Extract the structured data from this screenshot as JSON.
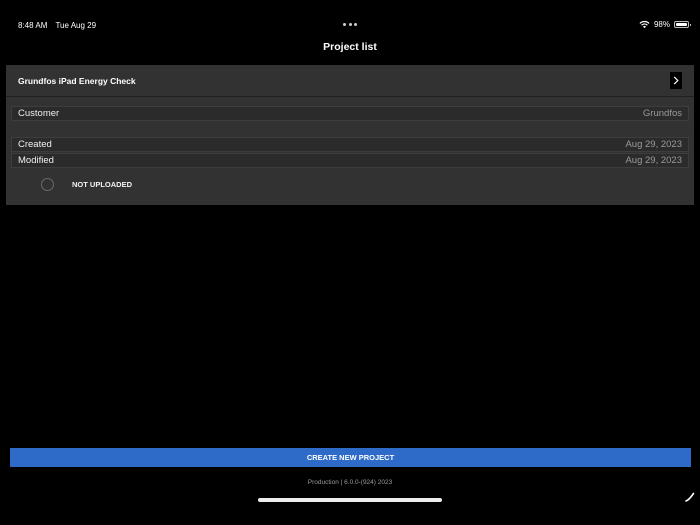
{
  "status_bar": {
    "time": "8:48 AM",
    "date": "Tue Aug 29",
    "battery": "98%",
    "icons": [
      "multitasking-dots-icon",
      "wifi-icon",
      "battery-icon"
    ]
  },
  "nav": {
    "title": "Project list"
  },
  "project": {
    "name": "Grundfos iPad Energy Check",
    "chevron_icon": "chevron-right-icon",
    "customer_label": "Customer",
    "customer_value": "Grundfos",
    "created_label": "Created",
    "created_value": "Aug 29, 2023",
    "modified_label": "Modified",
    "modified_value": "Aug 29, 2023",
    "upload_status": "NOT UPLOADED"
  },
  "actions": {
    "create_label": "CREATE NEW PROJECT"
  },
  "footer": {
    "version": "Production | 6.0.0-(924) 2023",
    "pen_icon": "pencil-icon"
  },
  "colors": {
    "background": "#000000",
    "card": "#323232",
    "row": "#2b2b2b",
    "accent": "#2e6bc9",
    "muted_text": "#9a9a9a"
  }
}
